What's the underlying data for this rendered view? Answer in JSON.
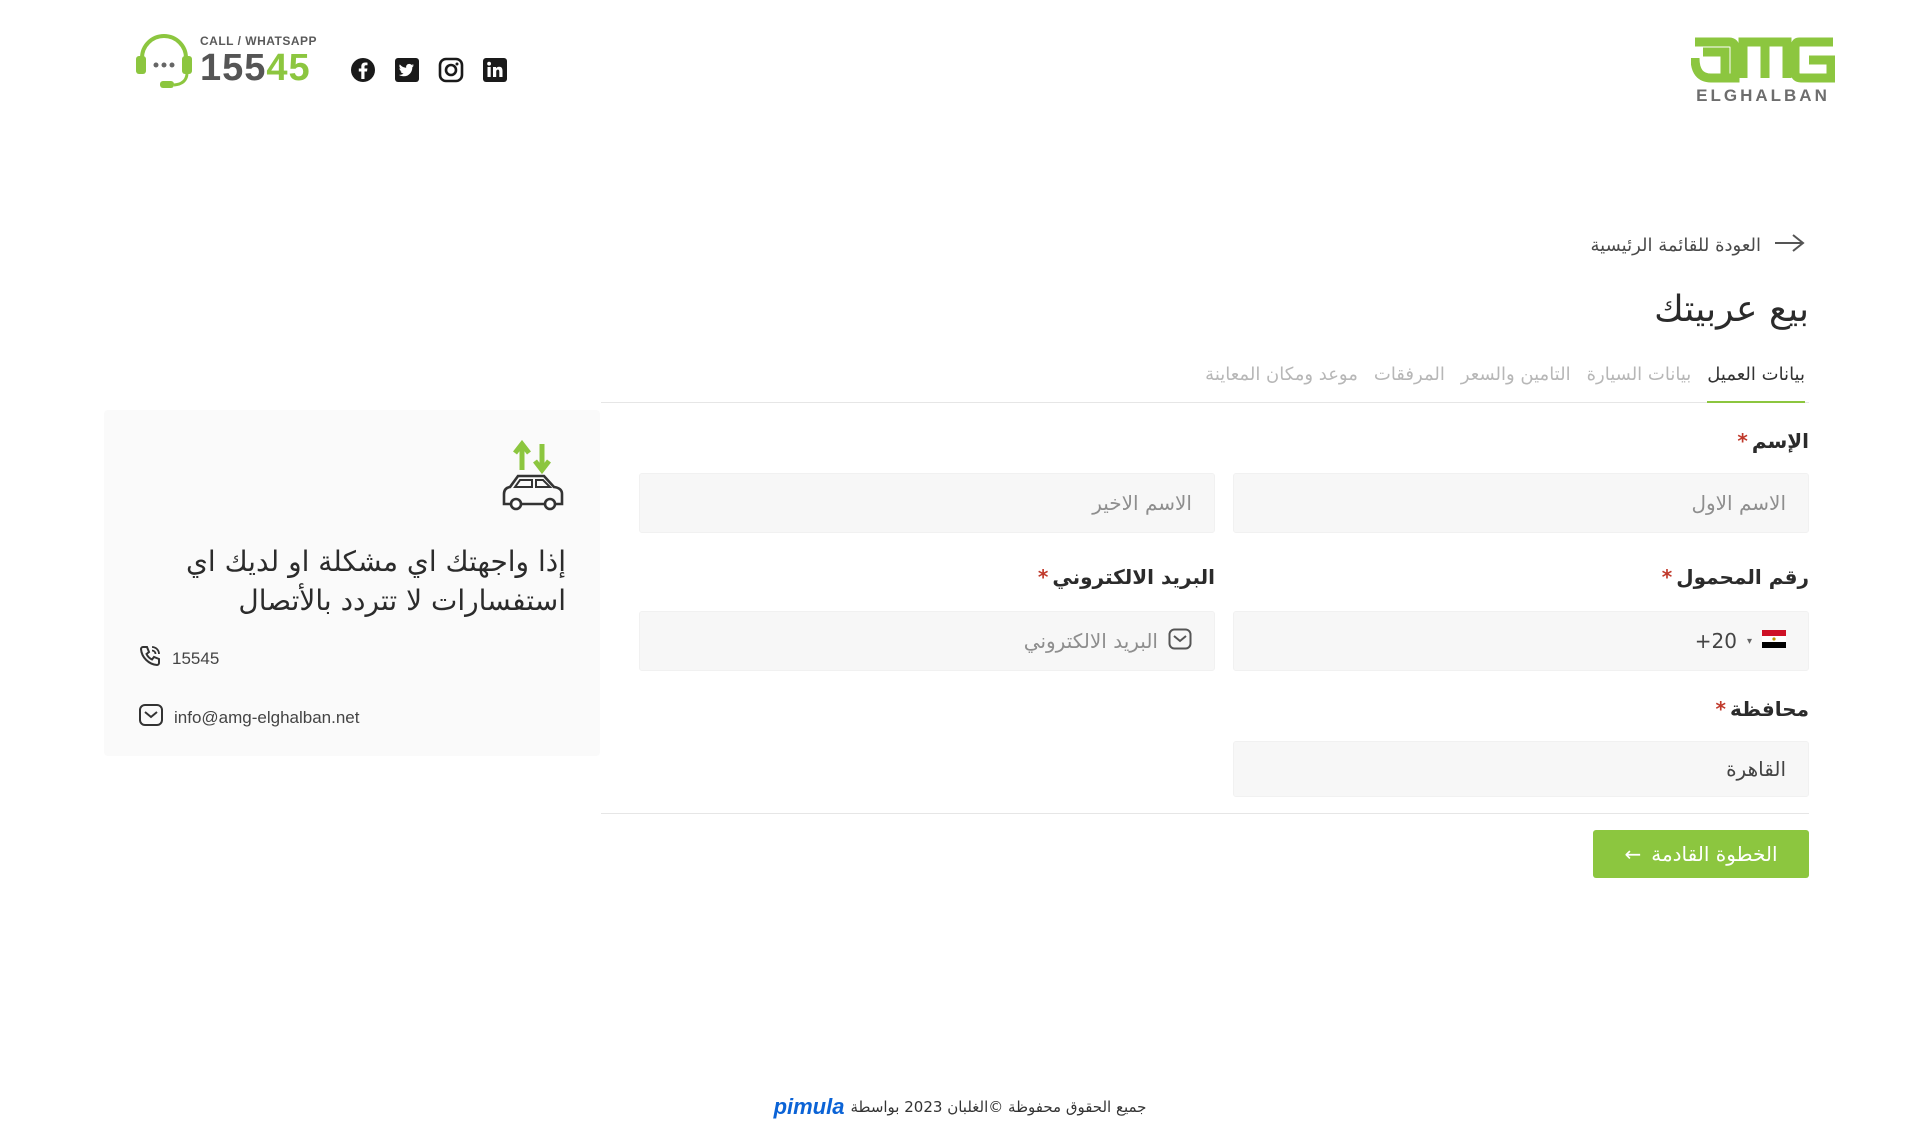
{
  "header": {
    "hotline": {
      "caption": "CALL / WHATSAPP",
      "number_start": "155",
      "number_end": "45",
      "icon": "headset-icon"
    },
    "socials": [
      {
        "name": "facebook",
        "icon": "facebook-icon"
      },
      {
        "name": "twitter",
        "icon": "twitter-icon"
      },
      {
        "name": "instagram",
        "icon": "instagram-icon"
      },
      {
        "name": "linkedin",
        "icon": "linkedin-icon"
      }
    ],
    "logo": {
      "mark": "amg",
      "subtitle": "ELGHALBAN",
      "registered": "®"
    }
  },
  "main": {
    "back_label": "العودة للقائمة الرئيسية",
    "title": "بيع عربيتك",
    "tabs": [
      {
        "label": "بيانات العميل",
        "active": true
      },
      {
        "label": "بيانات السيارة",
        "active": false
      },
      {
        "label": "التامين والسعر",
        "active": false
      },
      {
        "label": "المرفقات",
        "active": false
      },
      {
        "label": "موعد ومكان المعاينة",
        "active": false
      }
    ],
    "form": {
      "name_label": "الإسم",
      "first_name_placeholder": "الاسم الاول",
      "last_name_placeholder": "الاسم الاخير",
      "phone_label": "رقم المحمول",
      "phone_code": "+20",
      "phone_code_caret": "▾",
      "email_label": "البريد الالكتروني",
      "email_placeholder": "البريد الالكتروني",
      "governorate_label": "محافظة",
      "governorate_value": "القاهرة",
      "required_mark": "*"
    },
    "next_button": {
      "label": "الخطوة القادمة",
      "arrow": "←"
    }
  },
  "support": {
    "message": "إذا واجهتك اي مشكلة او لديك اي استفسارات لا تتردد بالأتصال",
    "phone": "15545",
    "email": "info@amg-elghalban.net"
  },
  "footer": {
    "text": "جميع الحقوق محفوظة ©الغلبان 2023 بواسطة",
    "brand": "pimula"
  },
  "colors": {
    "accent": "#8cc63f",
    "required": "#c0392b",
    "brand_footer": "#0b63d6"
  }
}
